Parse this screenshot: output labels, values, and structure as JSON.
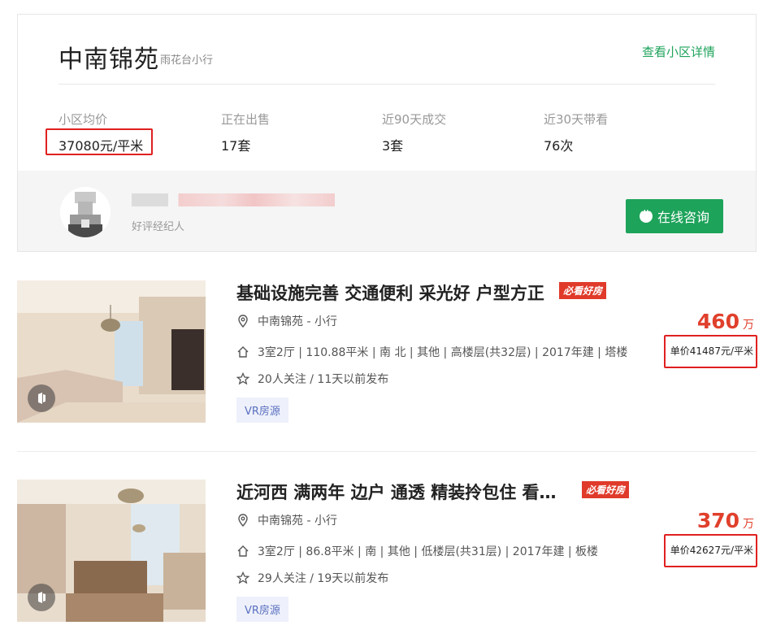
{
  "community": {
    "name": "中南锦苑",
    "area": "雨花台小行",
    "detail_link": "查看小区详情",
    "stats": [
      {
        "label": "小区均价",
        "value": "37080元/平米"
      },
      {
        "label": "正在出售",
        "value": "17套"
      },
      {
        "label": "近90天成交",
        "value": "3套"
      },
      {
        "label": "近30天带看",
        "value": "76次"
      }
    ],
    "agent": {
      "role": "好评经纪人",
      "consult_label": "在线咨询"
    }
  },
  "listings": [
    {
      "title": "基础设施完善 交通便利 采光好 户型方正",
      "tag": "必看好房",
      "location": "中南锦苑 - 小行",
      "house_info": "3室2厅 | 110.88平米 | 南 北 | 其他 | 高楼层(共32层) | 2017年建 | 塔楼",
      "follow_info": "20人关注 / 11天以前发布",
      "vr_tag": "VR房源",
      "total_price": "460",
      "total_unit": "万",
      "unit_price": "单价41487元/平米"
    },
    {
      "title": "近河西 满两年 边户 通透 精装拎包住 看…",
      "tag": "必看好房",
      "location": "中南锦苑 - 小行",
      "house_info": "3室2厅 | 86.8平米 | 南 | 其他 | 低楼层(共31层) | 2017年建 | 板楼",
      "follow_info": "29人关注 / 19天以前发布",
      "vr_tag": "VR房源",
      "total_price": "370",
      "total_unit": "万",
      "unit_price": "单价42627元/平米"
    }
  ],
  "colors": {
    "brand_green": "#1ea35b",
    "price_red": "#e0402c",
    "highlight_red": "#e02020",
    "tag_red": "#e03a2a"
  }
}
